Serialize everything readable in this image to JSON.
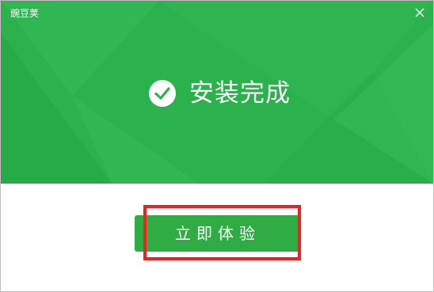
{
  "window": {
    "title": "豌豆荚",
    "close_icon": "close-icon"
  },
  "banner": {
    "status_icon": "check-circle-icon",
    "status_text": "安装完成",
    "background_color": "#2bb24c"
  },
  "actions": {
    "primary_label": "立即体验",
    "primary_color": "#2fac44",
    "highlight_color": "#ee2020"
  }
}
